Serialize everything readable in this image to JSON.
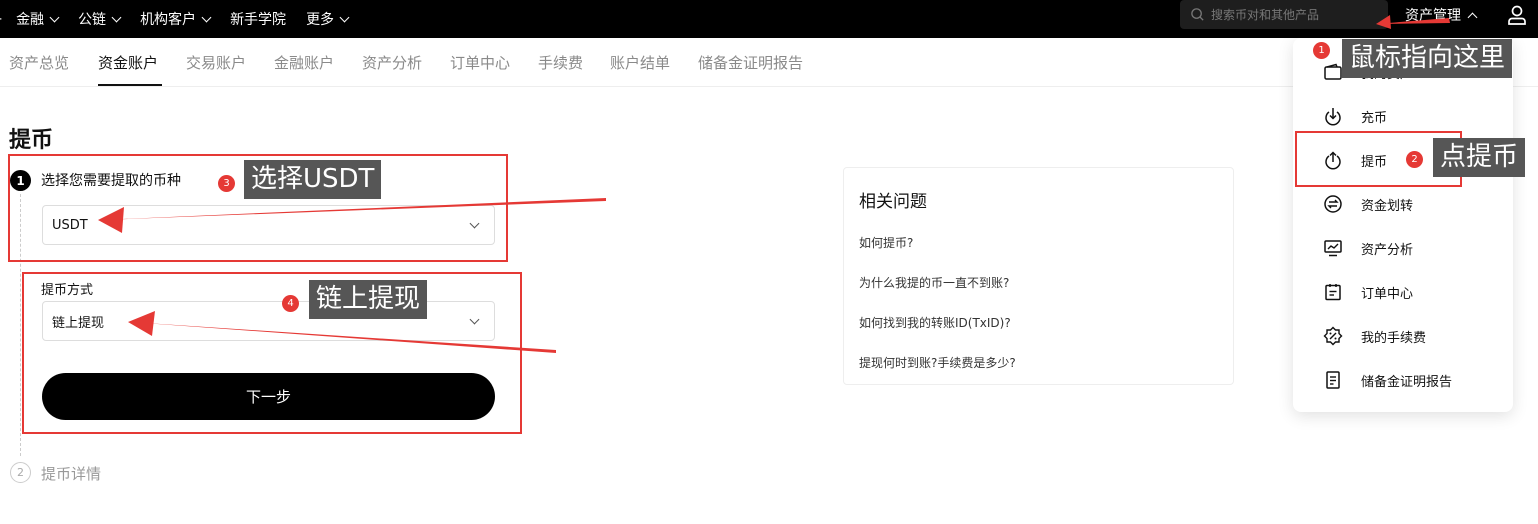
{
  "topnav": {
    "edge_glyph": "-",
    "items": [
      {
        "label": "金融",
        "has_dropdown": true
      },
      {
        "label": "公链",
        "has_dropdown": true
      },
      {
        "label": "机构客户",
        "has_dropdown": true
      },
      {
        "label": "新手学院",
        "has_dropdown": false
      },
      {
        "label": "更多",
        "has_dropdown": true
      }
    ],
    "search_placeholder": "搜索币对和其他产品",
    "asset_management": "资产管理"
  },
  "subtabs": [
    "资产总览",
    "资金账户",
    "交易账户",
    "金融账户",
    "资产分析",
    "订单中心",
    "手续费",
    "账户结单",
    "储备金证明报告"
  ],
  "active_subtab": "资金账户",
  "page": {
    "title": "提币",
    "step1": {
      "number": "1",
      "label": "选择您需要提取的币种",
      "coin_value": "USDT"
    },
    "method": {
      "label": "提币方式",
      "value": "链上提现"
    },
    "next_button": "下一步",
    "step2": {
      "number": "2",
      "label": "提币详情"
    }
  },
  "faq": {
    "title": "相关问题",
    "links": [
      "如何提币?",
      "为什么我提的币一直不到账?",
      "如何找到我的转账ID(TxID)?",
      "提现何时到账?手续费是多少?"
    ]
  },
  "dropdown": {
    "items": [
      {
        "label": "我的资产",
        "icon": "wallet-icon"
      },
      {
        "label": "充币",
        "icon": "deposit-icon"
      },
      {
        "label": "提币",
        "icon": "withdraw-icon"
      },
      {
        "label": "资金划转",
        "icon": "transfer-icon"
      },
      {
        "label": "资产分析",
        "icon": "analysis-icon"
      },
      {
        "label": "订单中心",
        "icon": "order-icon"
      },
      {
        "label": "我的手续费",
        "icon": "fee-icon"
      },
      {
        "label": "储备金证明报告",
        "icon": "report-icon"
      }
    ]
  },
  "annotations": [
    {
      "num": "1",
      "text": "鼠标指向这里"
    },
    {
      "num": "2",
      "text": "点提币"
    },
    {
      "num": "3",
      "text": "选择USDT"
    },
    {
      "num": "4",
      "text": "链上提现"
    }
  ],
  "colors": {
    "annotation_red": "#e53935",
    "callout_bg": "#565656",
    "topbar_bg": "#000000"
  }
}
